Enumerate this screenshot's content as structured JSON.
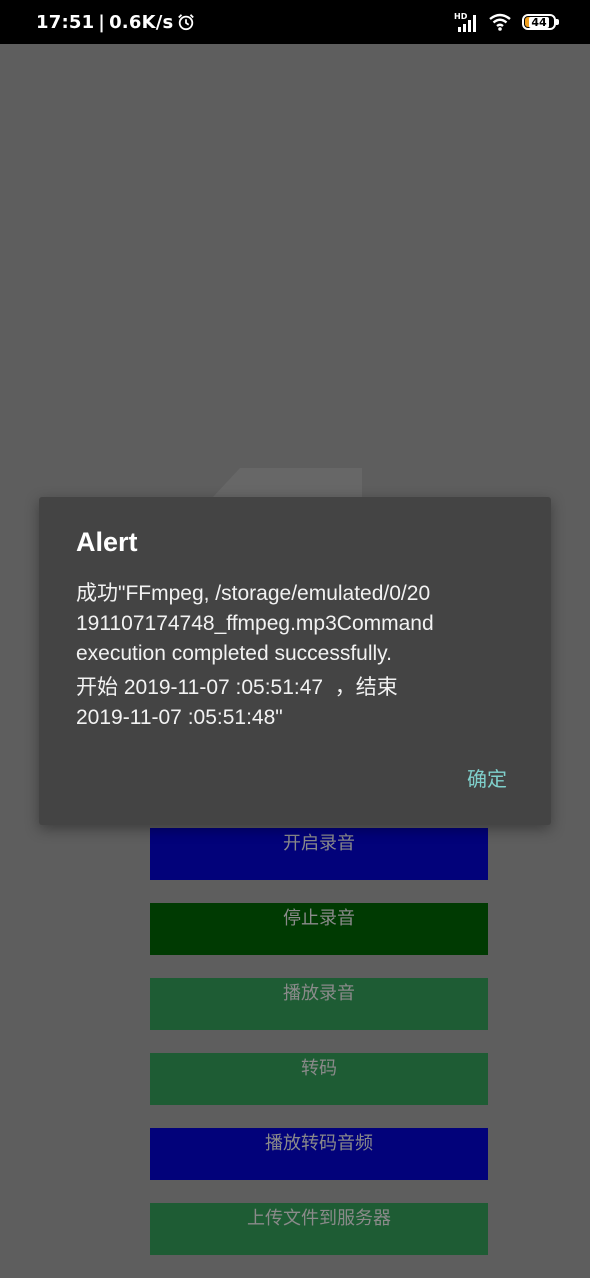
{
  "status_bar": {
    "time": "17:51",
    "separator": "|",
    "net_speed": "0.6K/s",
    "alarm_icon": "alarm-clock-icon",
    "signal_icon": "cell-signal-icon",
    "signal_label": "HD",
    "wifi_icon": "wifi-icon",
    "battery_level": "44",
    "battery_color": "#f0a020"
  },
  "background": {
    "buttons": [
      {
        "label": "开启录音",
        "color": "#02027a"
      },
      {
        "label": "停止录音",
        "color": "#003a02"
      },
      {
        "label": "播放录音",
        "color": "#1e5c34"
      },
      {
        "label": "转码",
        "color": "#1e5c34"
      },
      {
        "label": "播放转码音频",
        "color": "#02027a"
      },
      {
        "label": "上传文件到服务器",
        "color": "#1e5c34"
      }
    ]
  },
  "dialog": {
    "title": "Alert",
    "message_lines": [
      "成功\"FFmpeg, /storage/emulated/0/20",
      "191107174748_ffmpeg.mp3Command",
      "execution completed successfully.",
      "开始 2019-11-07 :05:51:47  ，结束",
      "2019-11-07 :05:51:48\""
    ],
    "ok_label": "确定",
    "accent_color": "#7fd0cc"
  }
}
